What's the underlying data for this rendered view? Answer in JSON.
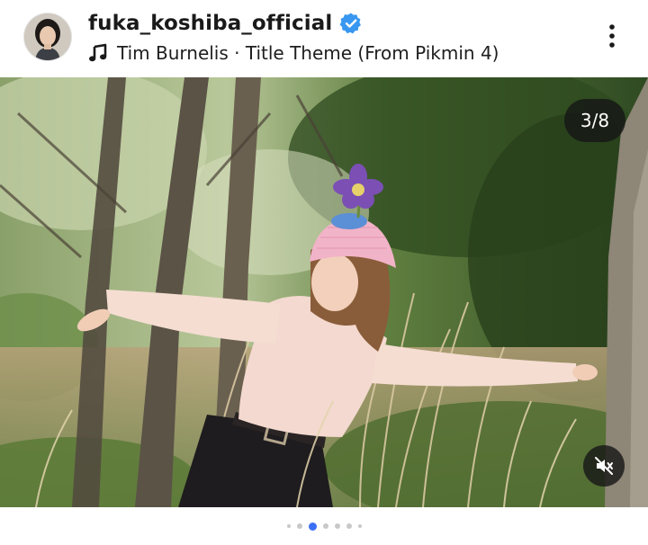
{
  "post": {
    "username": "fuka_koshiba_official",
    "verified": true,
    "audio_text": "Tim Burnelis · Title Theme (From Pikmin 4)",
    "more_icon": "more-vertical-icon",
    "music_icon": "music-note-icon",
    "verified_icon": "verified-badge-icon"
  },
  "media": {
    "counter": "3/8",
    "current_index": 3,
    "total": 8,
    "mute_icon": "speaker-muted-icon"
  },
  "carousel_dots": {
    "count": 8,
    "active": 3
  },
  "colors": {
    "verified_blue": "#3897f0",
    "active_dot": "#3b6ff5",
    "inactive_dot": "#c8c8c8"
  }
}
